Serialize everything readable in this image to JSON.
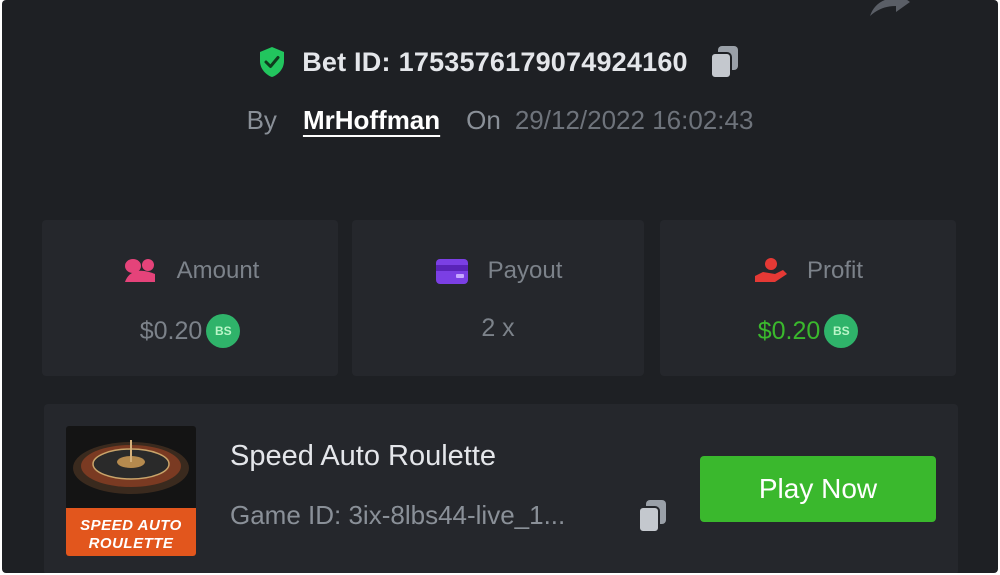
{
  "bet": {
    "id_label": "Bet ID:",
    "id_value": "1753576179074924160",
    "by_label": "By",
    "username": "MrHoffman",
    "on_label": "On",
    "date": "29/12/2022 16:02:43"
  },
  "stats": {
    "amount": {
      "label": "Amount",
      "value": "$0.20",
      "icon": "coins-icon",
      "icon_color": "#e5437a",
      "value_color": "#7c828a"
    },
    "payout": {
      "label": "Payout",
      "value": "2 x",
      "icon": "wallet-icon",
      "icon_color": "#7b3fe4",
      "value_color": "#7c828a"
    },
    "profit": {
      "label": "Profit",
      "value": "$0.20",
      "icon": "hand-coin-icon",
      "icon_color": "#e53935",
      "value_color": "#3ab82d"
    }
  },
  "coin_badge": "BS",
  "game": {
    "title": "Speed Auto Roulette",
    "game_id": "Game ID: 3ix-8lbs44-live_1...",
    "thumb_line1": "SPEED AUTO",
    "thumb_line2": "ROULETTE",
    "play_label": "Play Now"
  },
  "colors": {
    "panel_bg": "#1e2024",
    "card_bg": "#25272c",
    "accent_green": "#3ab82d",
    "shield_green": "#22c55e"
  }
}
